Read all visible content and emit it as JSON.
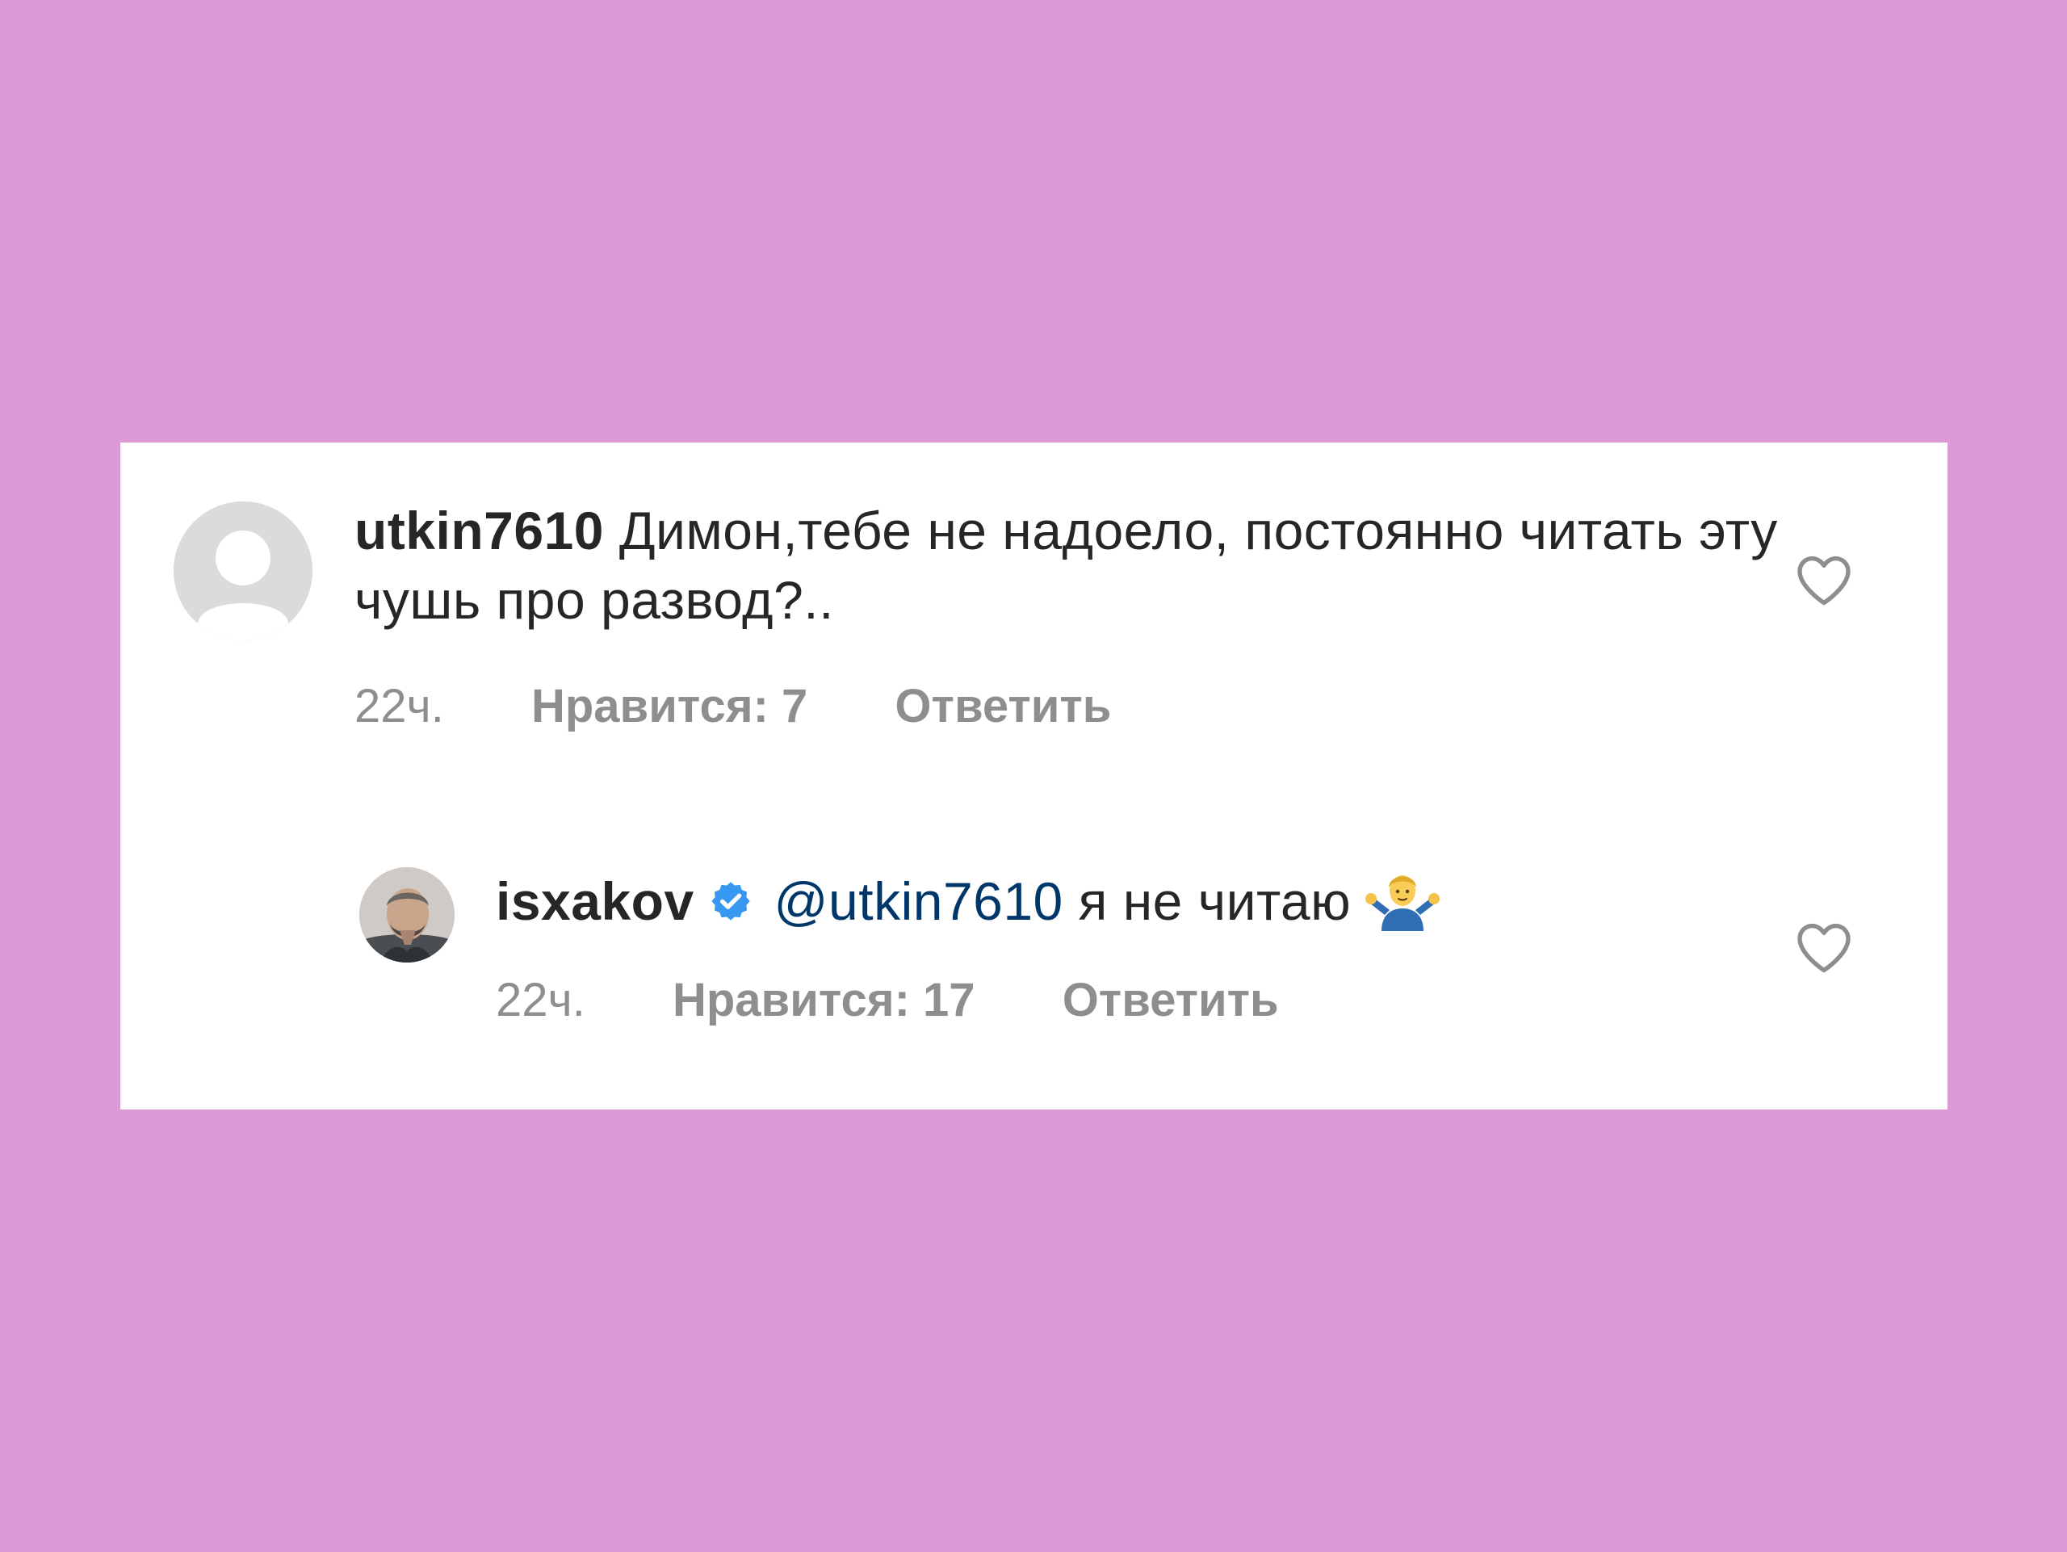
{
  "colors": {
    "background": "#dc9bd7",
    "card": "#ffffff",
    "primary_text": "#262626",
    "secondary_text": "#8e8e8e",
    "mention": "#00376b",
    "verified": "#3897f0"
  },
  "comments": [
    {
      "username": "utkin7610",
      "text": "Димон,тебе не надоело, постоянно читать эту чушь про развод?..",
      "time": "22ч.",
      "likes": "Нравится: 7",
      "reply": "Ответить",
      "avatar_icon": "default-avatar-icon",
      "like_icon": "heart-outline-icon"
    },
    {
      "username": "isxakov",
      "verified_icon": "verified-badge-icon",
      "mention": "@utkin7610",
      "text": "я не читаю",
      "emoji_icon": "man-shrugging-emoji-icon",
      "time": "22ч.",
      "likes": "Нравится: 17",
      "reply": "Ответить",
      "avatar_icon": "profile-photo-icon",
      "like_icon": "heart-outline-icon"
    }
  ]
}
